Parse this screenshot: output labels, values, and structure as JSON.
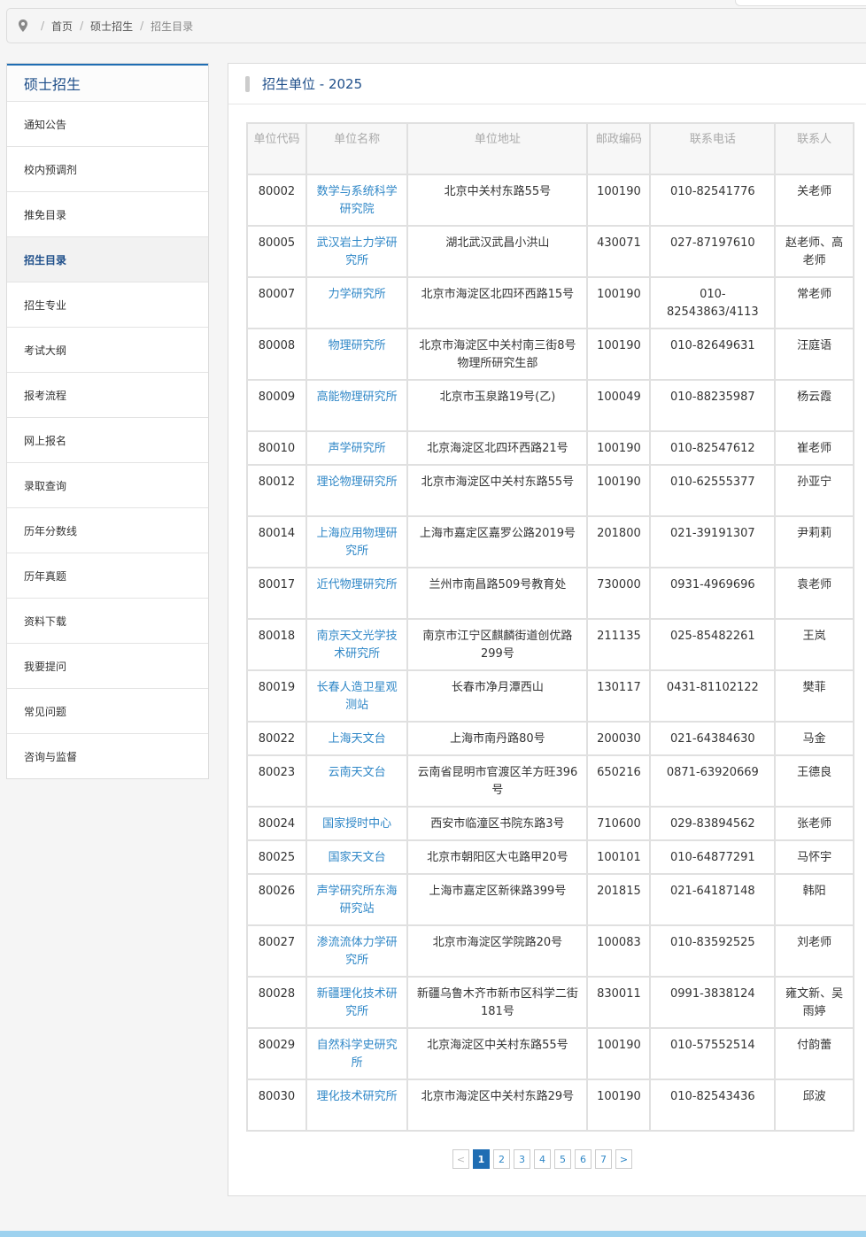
{
  "breadcrumb": {
    "home": "首页",
    "section": "硕士招生",
    "current": "招生目录"
  },
  "sidebar": {
    "title": "硕士招生",
    "items": [
      {
        "label": "通知公告"
      },
      {
        "label": "校内预调剂"
      },
      {
        "label": "推免目录"
      },
      {
        "label": "招生目录",
        "active": true
      },
      {
        "label": "招生专业"
      },
      {
        "label": "考试大纲"
      },
      {
        "label": "报考流程"
      },
      {
        "label": "网上报名"
      },
      {
        "label": "录取查询"
      },
      {
        "label": "历年分数线"
      },
      {
        "label": "历年真题"
      },
      {
        "label": "资料下载"
      },
      {
        "label": "我要提问"
      },
      {
        "label": "常见问题"
      },
      {
        "label": "咨询与监督"
      }
    ]
  },
  "main": {
    "title": "招生单位 - 2025",
    "columns": [
      "单位代码",
      "单位名称",
      "单位地址",
      "邮政编码",
      "联系电话",
      "联系人"
    ],
    "rows": [
      [
        "80002",
        "数学与系统科学研究院",
        "北京中关村东路55号",
        "100190",
        "010-82541776",
        "关老师"
      ],
      [
        "80005",
        "武汉岩土力学研究所",
        "湖北武汉武昌小洪山",
        "430071",
        "027-87197610",
        "赵老师、高老师"
      ],
      [
        "80007",
        "力学研究所",
        "北京市海淀区北四环西路15号",
        "100190",
        "010-82543863/4113",
        "常老师"
      ],
      [
        "80008",
        "物理研究所",
        "北京市海淀区中关村南三街8号物理所研究生部",
        "100190",
        "010-82649631",
        "汪庭语"
      ],
      [
        "80009",
        "高能物理研究所",
        "北京市玉泉路19号(乙)",
        "100049",
        "010-88235987",
        "杨云霞"
      ],
      [
        "80010",
        "声学研究所",
        "北京海淀区北四环西路21号",
        "100190",
        "010-82547612",
        "崔老师"
      ],
      [
        "80012",
        "理论物理研究所",
        "北京市海淀区中关村东路55号",
        "100190",
        "010-62555377",
        "孙亚宁"
      ],
      [
        "80014",
        "上海应用物理研究所",
        "上海市嘉定区嘉罗公路2019号",
        "201800",
        "021-39191307",
        "尹莉莉"
      ],
      [
        "80017",
        "近代物理研究所",
        "兰州市南昌路509号教育处",
        "730000",
        "0931-4969696",
        "袁老师"
      ],
      [
        "80018",
        "南京天文光学技术研究所",
        "南京市江宁区麒麟街道创优路299号",
        "211135",
        "025-85482261",
        "王岚"
      ],
      [
        "80019",
        "长春人造卫星观测站",
        "长春市净月潭西山",
        "130117",
        "0431-81102122",
        "樊菲"
      ],
      [
        "80022",
        "上海天文台",
        "上海市南丹路80号",
        "200030",
        "021-64384630",
        "马金"
      ],
      [
        "80023",
        "云南天文台",
        "云南省昆明市官渡区羊方旺396号",
        "650216",
        "0871-63920669",
        "王德良"
      ],
      [
        "80024",
        "国家授时中心",
        "西安市临潼区书院东路3号",
        "710600",
        "029-83894562",
        "张老师"
      ],
      [
        "80025",
        "国家天文台",
        "北京市朝阳区大屯路甲20号",
        "100101",
        "010-64877291",
        "马怀宇"
      ],
      [
        "80026",
        "声学研究所东海研究站",
        "上海市嘉定区新徕路399号",
        "201815",
        "021-64187148",
        "韩阳"
      ],
      [
        "80027",
        "渗流流体力学研究所",
        "北京市海淀区学院路20号",
        "100083",
        "010-83592525",
        "刘老师"
      ],
      [
        "80028",
        "新疆理化技术研究所",
        "新疆乌鲁木齐市新市区科学二街181号",
        "830011",
        "0991-3838124",
        "雍文新、吴雨婷"
      ],
      [
        "80029",
        "自然科学史研究所",
        "北京海淀区中关村东路55号",
        "100190",
        "010-57552514",
        "付韵蕾"
      ],
      [
        "80030",
        "理化技术研究所",
        "北京市海淀区中关村东路29号",
        "100190",
        "010-82543436",
        "邱波"
      ]
    ],
    "pagination": {
      "prev": "<",
      "next": ">",
      "pages": [
        "1",
        "2",
        "3",
        "4",
        "5",
        "6",
        "7"
      ],
      "current": "1"
    }
  }
}
